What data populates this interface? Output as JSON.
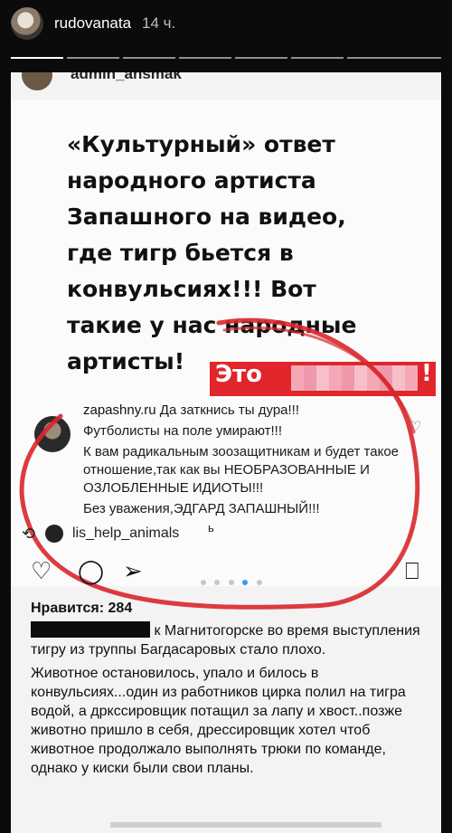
{
  "story": {
    "username": "rudovanata",
    "time": "14 ч."
  },
  "post": {
    "header_user": "admin_ansmak",
    "headline": "«Культурный» ответ народного артиста Запашного на видео, где тигр бьется в конвульсиях!!! Вот такие у нас народные артисты!",
    "banner_word": "Это",
    "banner_end": "!",
    "comment": {
      "user": "zapashny.ru",
      "line1": "Да заткнись ты дура!!!",
      "line2": "Футболисты на поле умирают!!!",
      "line3": "К вам радикальным зоозащитникам и будет такое отношение,так как вы НЕОБРАЗОВАННЫЕ И ОЗЛОБЛЕННЫЕ ИДИОТЫ!!!",
      "line4": "Без уважения,ЭДГАРД ЗАПАШНЫЙ!!!"
    },
    "repost_user": "lis_help_animals",
    "repost_suffix": "ь",
    "likes": "Нравится: 284",
    "caption": {
      "p1_tail": "к Магнитогорске во время выступления тигру из труппы Багдасаровых стало плохо.",
      "p2": "Животное остановилось, упало и билось в конвульсиях...один из работников цирка полил на тигра водой, а дркссировщик потащил за лапу и хвост..позже животно пришло в себя, дрессировщик хотел чтоб животное продолжало выполнять трюки по команде, однако у киски были свои планы."
    }
  },
  "icons": {
    "like": "heart-icon",
    "comment": "comment-icon",
    "share": "send-icon",
    "save": "bookmark-icon",
    "repost": "repost-icon"
  },
  "colors": {
    "accent_red": "#e0262a",
    "dot_active": "#3897f0"
  }
}
